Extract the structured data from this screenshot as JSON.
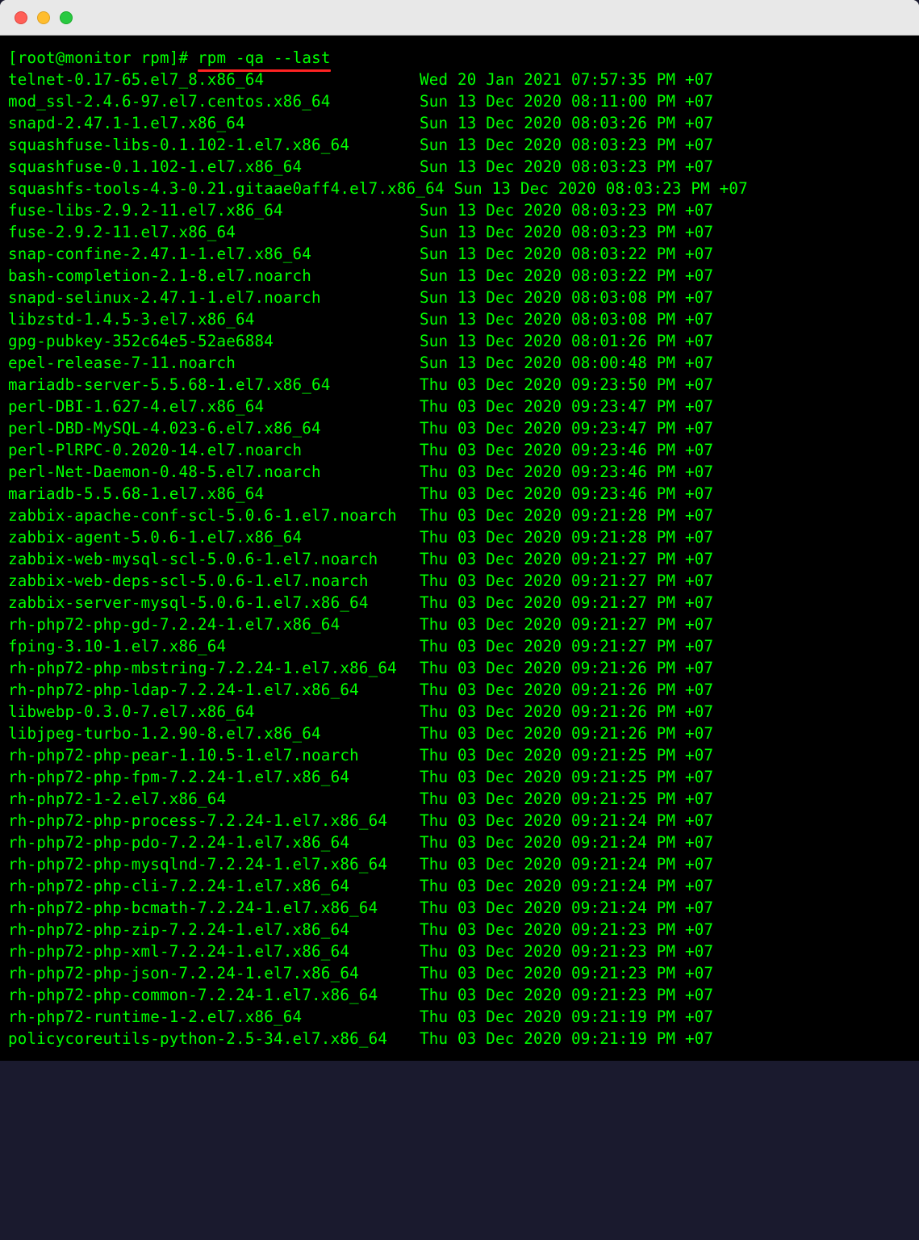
{
  "prompt": "[root@monitor rpm]# ",
  "command": "rpm -qa --last",
  "packages": [
    {
      "name": "telnet-0.17-65.el7_8.x86_64",
      "date": "Wed 20 Jan 2021 07:57:35 PM +07"
    },
    {
      "name": "mod_ssl-2.4.6-97.el7.centos.x86_64",
      "date": "Sun 13 Dec 2020 08:11:00 PM +07"
    },
    {
      "name": "snapd-2.47.1-1.el7.x86_64",
      "date": "Sun 13 Dec 2020 08:03:26 PM +07"
    },
    {
      "name": "squashfuse-libs-0.1.102-1.el7.x86_64",
      "date": "Sun 13 Dec 2020 08:03:23 PM +07"
    },
    {
      "name": "squashfuse-0.1.102-1.el7.x86_64",
      "date": "Sun 13 Dec 2020 08:03:23 PM +07"
    },
    {
      "name": "squashfs-tools-4.3-0.21.gitaae0aff4.el7.x86_64",
      "date": "Sun 13 Dec 2020 08:03:23 PM +07",
      "tight": true
    },
    {
      "name": "fuse-libs-2.9.2-11.el7.x86_64",
      "date": "Sun 13 Dec 2020 08:03:23 PM +07"
    },
    {
      "name": "fuse-2.9.2-11.el7.x86_64",
      "date": "Sun 13 Dec 2020 08:03:23 PM +07"
    },
    {
      "name": "snap-confine-2.47.1-1.el7.x86_64",
      "date": "Sun 13 Dec 2020 08:03:22 PM +07"
    },
    {
      "name": "bash-completion-2.1-8.el7.noarch",
      "date": "Sun 13 Dec 2020 08:03:22 PM +07"
    },
    {
      "name": "snapd-selinux-2.47.1-1.el7.noarch",
      "date": "Sun 13 Dec 2020 08:03:08 PM +07"
    },
    {
      "name": "libzstd-1.4.5-3.el7.x86_64",
      "date": "Sun 13 Dec 2020 08:03:08 PM +07"
    },
    {
      "name": "gpg-pubkey-352c64e5-52ae6884",
      "date": "Sun 13 Dec 2020 08:01:26 PM +07"
    },
    {
      "name": "epel-release-7-11.noarch",
      "date": "Sun 13 Dec 2020 08:00:48 PM +07"
    },
    {
      "name": "mariadb-server-5.5.68-1.el7.x86_64",
      "date": "Thu 03 Dec 2020 09:23:50 PM +07"
    },
    {
      "name": "perl-DBI-1.627-4.el7.x86_64",
      "date": "Thu 03 Dec 2020 09:23:47 PM +07"
    },
    {
      "name": "perl-DBD-MySQL-4.023-6.el7.x86_64",
      "date": "Thu 03 Dec 2020 09:23:47 PM +07"
    },
    {
      "name": "perl-PlRPC-0.2020-14.el7.noarch",
      "date": "Thu 03 Dec 2020 09:23:46 PM +07"
    },
    {
      "name": "perl-Net-Daemon-0.48-5.el7.noarch",
      "date": "Thu 03 Dec 2020 09:23:46 PM +07"
    },
    {
      "name": "mariadb-5.5.68-1.el7.x86_64",
      "date": "Thu 03 Dec 2020 09:23:46 PM +07"
    },
    {
      "name": "zabbix-apache-conf-scl-5.0.6-1.el7.noarch",
      "date": "Thu 03 Dec 2020 09:21:28 PM +07"
    },
    {
      "name": "zabbix-agent-5.0.6-1.el7.x86_64",
      "date": "Thu 03 Dec 2020 09:21:28 PM +07"
    },
    {
      "name": "zabbix-web-mysql-scl-5.0.6-1.el7.noarch",
      "date": "Thu 03 Dec 2020 09:21:27 PM +07"
    },
    {
      "name": "zabbix-web-deps-scl-5.0.6-1.el7.noarch",
      "date": "Thu 03 Dec 2020 09:21:27 PM +07"
    },
    {
      "name": "zabbix-server-mysql-5.0.6-1.el7.x86_64",
      "date": "Thu 03 Dec 2020 09:21:27 PM +07"
    },
    {
      "name": "rh-php72-php-gd-7.2.24-1.el7.x86_64",
      "date": "Thu 03 Dec 2020 09:21:27 PM +07"
    },
    {
      "name": "fping-3.10-1.el7.x86_64",
      "date": "Thu 03 Dec 2020 09:21:27 PM +07"
    },
    {
      "name": "rh-php72-php-mbstring-7.2.24-1.el7.x86_64",
      "date": "Thu 03 Dec 2020 09:21:26 PM +07"
    },
    {
      "name": "rh-php72-php-ldap-7.2.24-1.el7.x86_64",
      "date": "Thu 03 Dec 2020 09:21:26 PM +07"
    },
    {
      "name": "libwebp-0.3.0-7.el7.x86_64",
      "date": "Thu 03 Dec 2020 09:21:26 PM +07"
    },
    {
      "name": "libjpeg-turbo-1.2.90-8.el7.x86_64",
      "date": "Thu 03 Dec 2020 09:21:26 PM +07"
    },
    {
      "name": "rh-php72-php-pear-1.10.5-1.el7.noarch",
      "date": "Thu 03 Dec 2020 09:21:25 PM +07"
    },
    {
      "name": "rh-php72-php-fpm-7.2.24-1.el7.x86_64",
      "date": "Thu 03 Dec 2020 09:21:25 PM +07"
    },
    {
      "name": "rh-php72-1-2.el7.x86_64",
      "date": "Thu 03 Dec 2020 09:21:25 PM +07"
    },
    {
      "name": "rh-php72-php-process-7.2.24-1.el7.x86_64",
      "date": "Thu 03 Dec 2020 09:21:24 PM +07"
    },
    {
      "name": "rh-php72-php-pdo-7.2.24-1.el7.x86_64",
      "date": "Thu 03 Dec 2020 09:21:24 PM +07"
    },
    {
      "name": "rh-php72-php-mysqlnd-7.2.24-1.el7.x86_64",
      "date": "Thu 03 Dec 2020 09:21:24 PM +07"
    },
    {
      "name": "rh-php72-php-cli-7.2.24-1.el7.x86_64",
      "date": "Thu 03 Dec 2020 09:21:24 PM +07"
    },
    {
      "name": "rh-php72-php-bcmath-7.2.24-1.el7.x86_64",
      "date": "Thu 03 Dec 2020 09:21:24 PM +07"
    },
    {
      "name": "rh-php72-php-zip-7.2.24-1.el7.x86_64",
      "date": "Thu 03 Dec 2020 09:21:23 PM +07"
    },
    {
      "name": "rh-php72-php-xml-7.2.24-1.el7.x86_64",
      "date": "Thu 03 Dec 2020 09:21:23 PM +07"
    },
    {
      "name": "rh-php72-php-json-7.2.24-1.el7.x86_64",
      "date": "Thu 03 Dec 2020 09:21:23 PM +07"
    },
    {
      "name": "rh-php72-php-common-7.2.24-1.el7.x86_64",
      "date": "Thu 03 Dec 2020 09:21:23 PM +07"
    },
    {
      "name": "rh-php72-runtime-1-2.el7.x86_64",
      "date": "Thu 03 Dec 2020 09:21:19 PM +07"
    },
    {
      "name": "policycoreutils-python-2.5-34.el7.x86_64",
      "date": "Thu 03 Dec 2020 09:21:19 PM +07"
    }
  ]
}
